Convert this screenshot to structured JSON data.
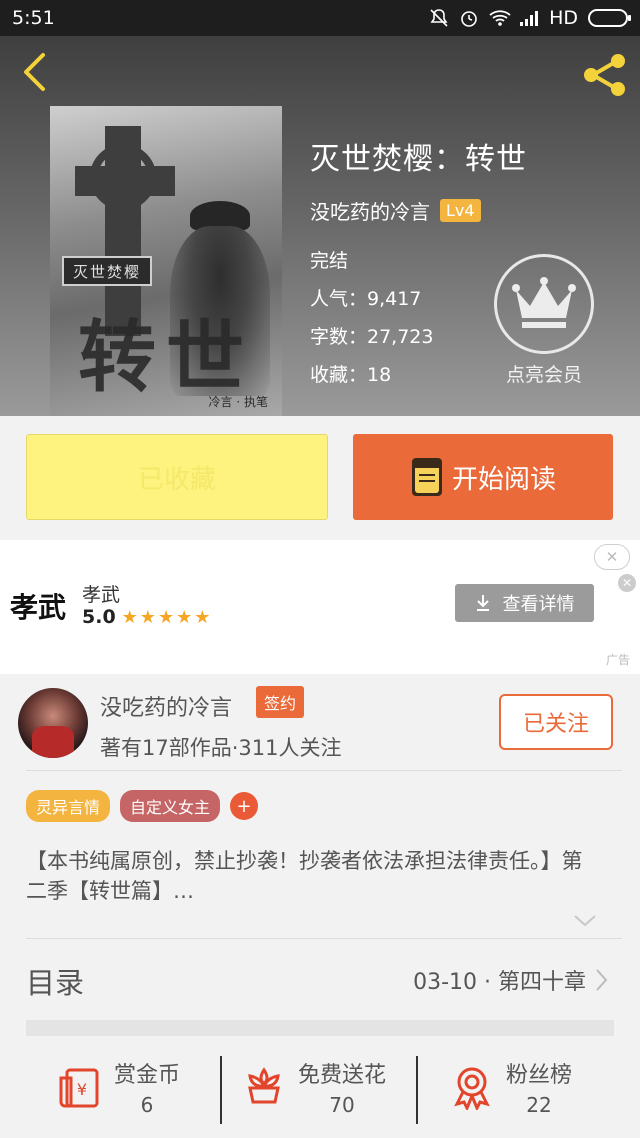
{
  "status_bar": {
    "time": "5:51",
    "network": "HD"
  },
  "book": {
    "title": "灭世焚樱：转世",
    "author": "没吃药的冷言",
    "author_level": "Lv4",
    "cover_plaque": "灭世焚樱",
    "cover_big_title": "转世",
    "cover_signature": "冷言 · 执笔",
    "status": "完结",
    "popularity": "人气：9,417",
    "word_count": "字数：27,723",
    "favorites": "收藏：18",
    "vip_label": "点亮会员"
  },
  "actions": {
    "favorited_label": "已收藏",
    "read_label": "开始阅读"
  },
  "ad": {
    "logo_text": "孝武",
    "app_name": "孝武",
    "rating": "5.0",
    "stars": "★★★★★",
    "button_label": "查看详情",
    "close_glyph": "✕",
    "tag": "广告"
  },
  "author_card": {
    "name": "没吃药的冷言",
    "sign_badge": "签约",
    "meta": "著有17部作品·311人关注",
    "follow_label": "已关注"
  },
  "tags": [
    {
      "label": "灵异言情"
    },
    {
      "label": "自定义女主"
    },
    {
      "label": "+"
    }
  ],
  "synopsis": "【本书纯属原创，禁止抄袭！抄袭者依法承担法律责任。】第二季【转世篇】…",
  "toc": {
    "label": "目录",
    "latest": "03-10 · 第四十章"
  },
  "bottom_bar": [
    {
      "title": "赏金币",
      "count": "6",
      "icon": "coin-envelope-icon"
    },
    {
      "title": "免费送花",
      "count": "70",
      "icon": "flower-icon"
    },
    {
      "title": "粉丝榜",
      "count": "22",
      "icon": "medal-icon"
    }
  ],
  "colors": {
    "accent": "#ea6a3a",
    "favorite_bg": "#fdf37e",
    "level_badge": "#f3b53f",
    "tag_pink": "#c56565"
  }
}
